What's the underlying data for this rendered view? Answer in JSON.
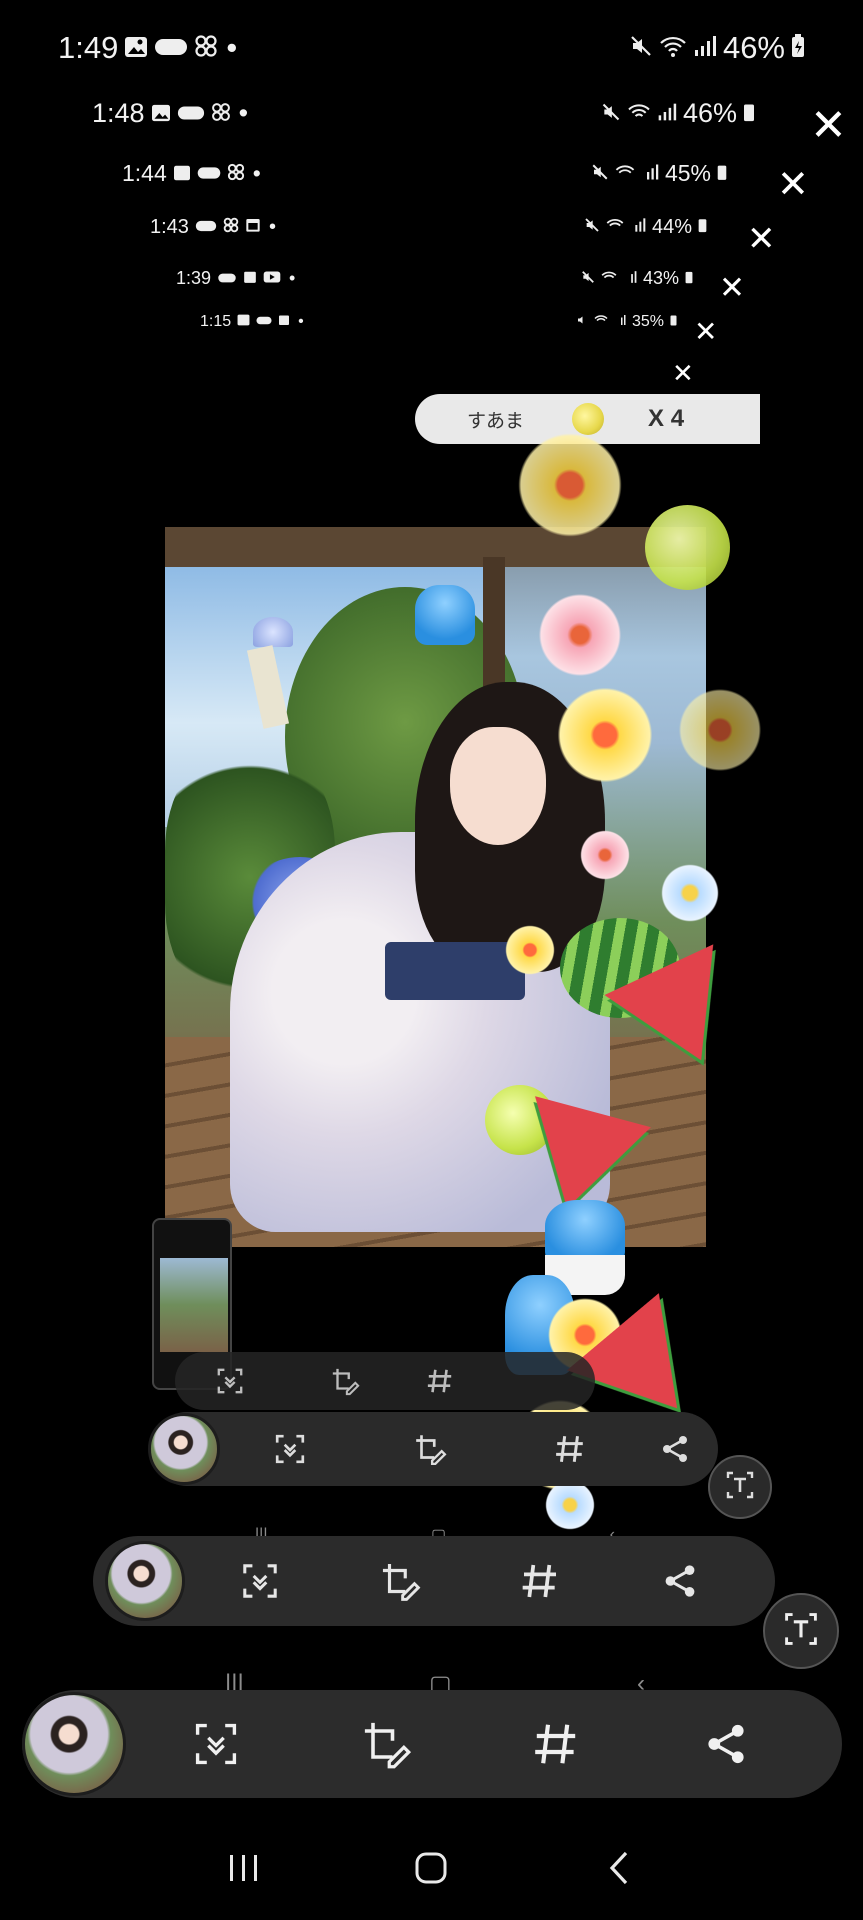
{
  "status_bars": [
    {
      "time": "1:49",
      "battery": "46%"
    },
    {
      "time": "1:48",
      "battery": "46%"
    },
    {
      "time": "1:44",
      "battery": "45%"
    },
    {
      "time": "1:43",
      "battery": "44%"
    },
    {
      "time": "1:39",
      "battery": "43%"
    },
    {
      "time": "1:15",
      "battery": "35%"
    }
  ],
  "close_glyph": "✕",
  "reward": {
    "name": "すあま",
    "count": "X 4"
  },
  "toolbar_icons": [
    "scroll-capture-icon",
    "edit-crop-icon",
    "hashtag-icon",
    "share-icon"
  ],
  "text_fab_icon": "text-extract-icon",
  "nav": {
    "recents_icon": "recents-icon",
    "home_icon": "home-icon",
    "back_icon": "back-icon"
  }
}
